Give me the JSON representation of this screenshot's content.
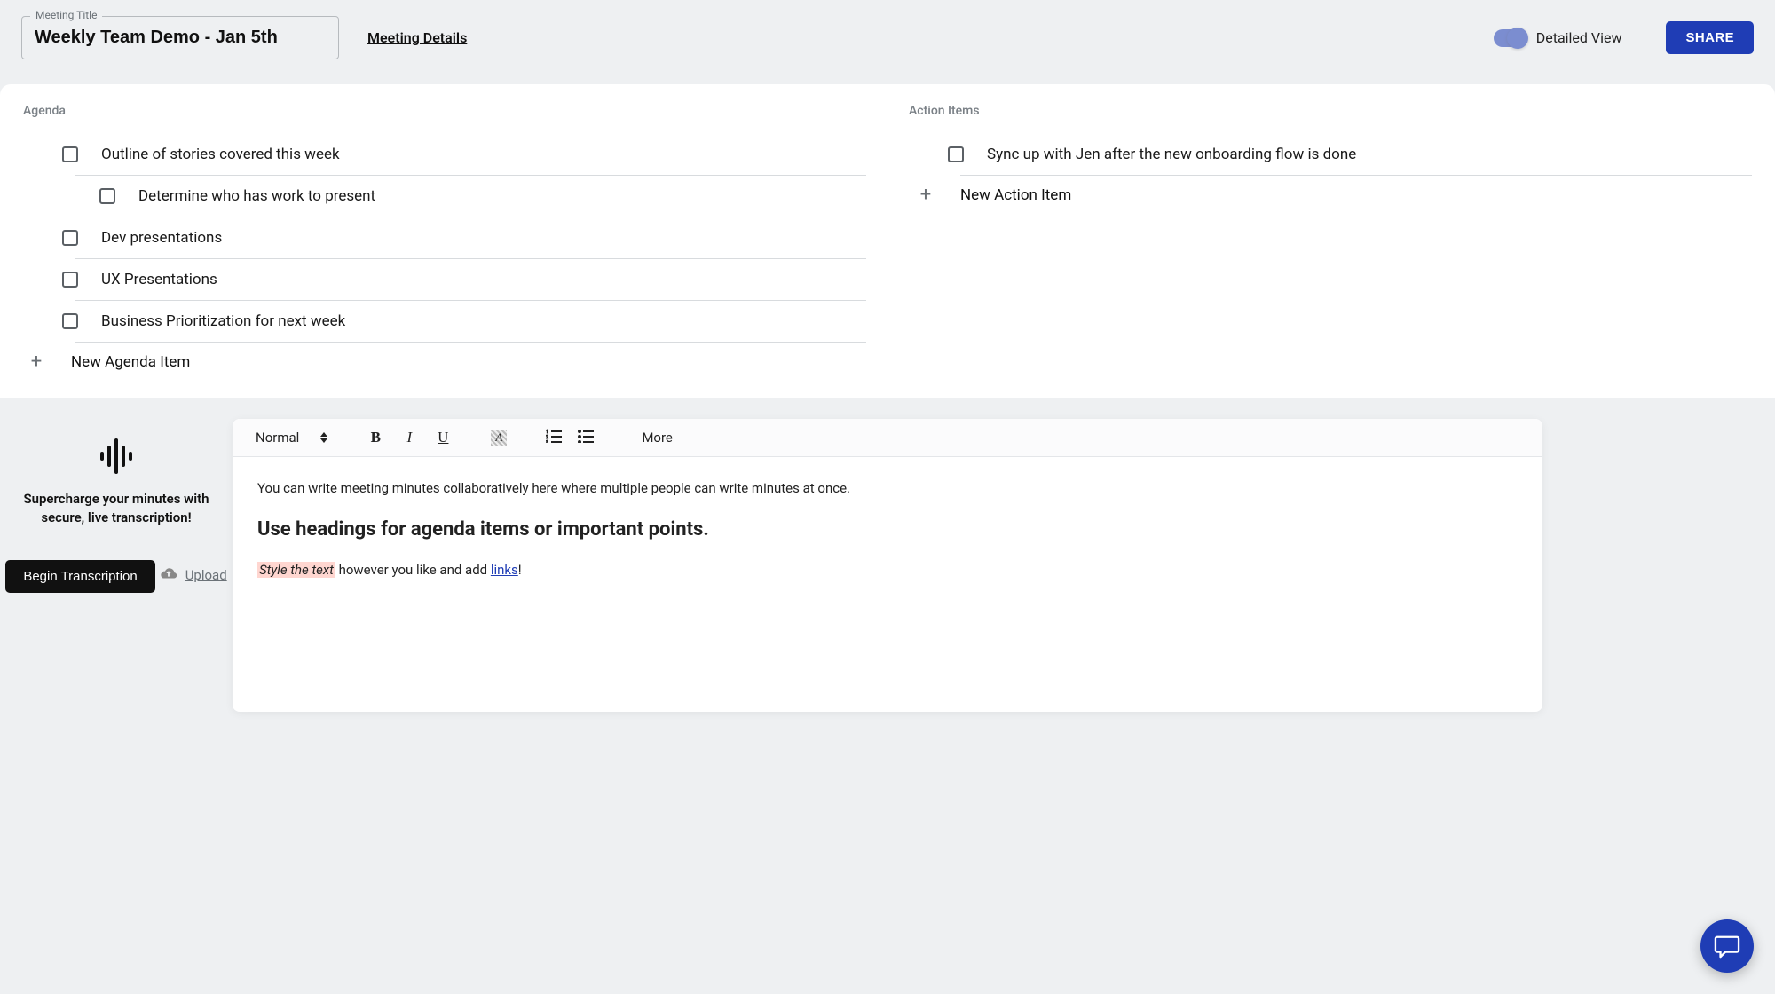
{
  "header": {
    "title_label": "Meeting Title",
    "title_value": "Weekly Team Demo - Jan 5th",
    "details_link": "Meeting Details",
    "toggle_label": "Detailed View",
    "share_label": "SHARE"
  },
  "agenda": {
    "title": "Agenda",
    "items": [
      {
        "text": "Outline of stories covered this week",
        "level": 0
      },
      {
        "text": "Determine who has work to present",
        "level": 1
      },
      {
        "text": "Dev presentations",
        "level": 0
      },
      {
        "text": "UX Presentations",
        "level": 0
      },
      {
        "text": "Business Prioritization for next week",
        "level": 0
      }
    ],
    "new_label": "New Agenda Item"
  },
  "actions": {
    "title": "Action Items",
    "items": [
      {
        "text": "Sync up with Jen after the new onboarding flow is done",
        "level": 0
      }
    ],
    "new_label": "New Action Item"
  },
  "transcription": {
    "cta_text": "Supercharge your minutes with secure, live transcription!",
    "begin_label": "Begin Transcription",
    "upload_label": "Upload"
  },
  "editor": {
    "style_select": "Normal",
    "more_label": "More",
    "para1": "You can write meeting minutes collaboratively here where multiple people can write minutes at once.",
    "heading": "Use headings for agenda items or important points.",
    "styled_text": "Style the text",
    "para2_mid": " however you like and add ",
    "link_text": "links",
    "para2_end": "!"
  }
}
